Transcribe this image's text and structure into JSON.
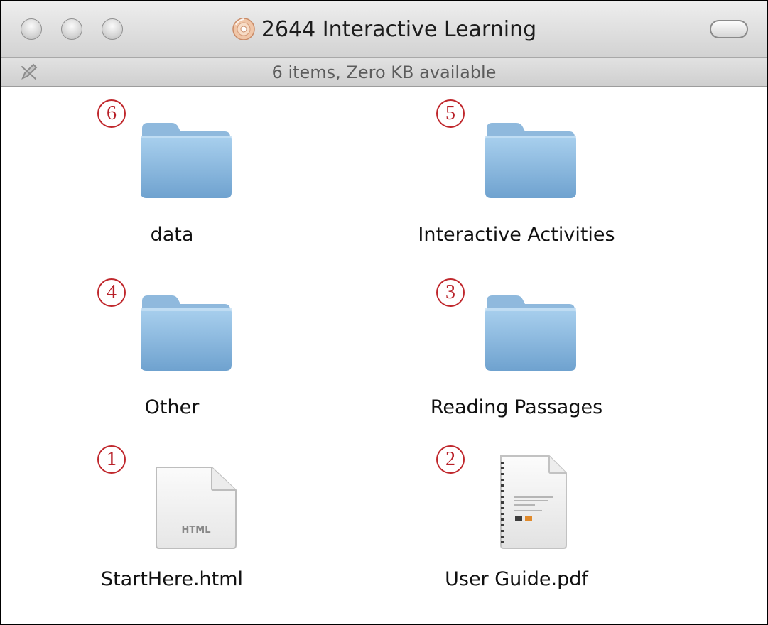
{
  "window": {
    "title": "2644 Interactive Learning",
    "status": "6 items, Zero KB available"
  },
  "items": {
    "data": {
      "label": "data",
      "badge": "6",
      "kind": "folder"
    },
    "interactive": {
      "label": "Interactive Activities",
      "badge": "5",
      "kind": "folder"
    },
    "other": {
      "label": "Other",
      "badge": "4",
      "kind": "folder"
    },
    "reading": {
      "label": "Reading Passages",
      "badge": "3",
      "kind": "folder"
    },
    "starthere": {
      "label": "StartHere.html",
      "badge": "1",
      "kind": "html",
      "icon_text": "HTML"
    },
    "userguide": {
      "label": "User Guide.pdf",
      "badge": "2",
      "kind": "pdf"
    }
  },
  "colors": {
    "badge": "#c0282d",
    "folder": "#8ebce0"
  }
}
